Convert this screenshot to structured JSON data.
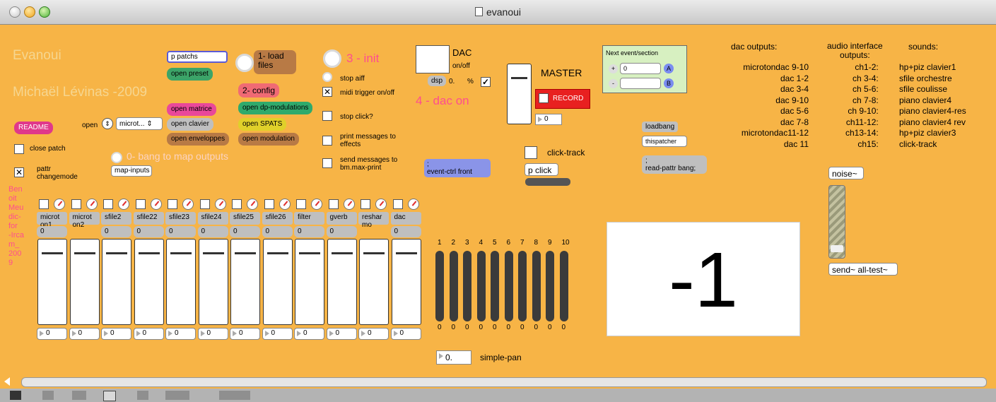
{
  "window": {
    "title": "evanoui"
  },
  "header": {
    "app_name": "Evanoui",
    "author": "Michaël Lévinas -2009"
  },
  "left": {
    "readme": "README",
    "open_label": "open",
    "open_select": "microt...",
    "close_patch": "close patch",
    "pattr_label": "pattr\nchangemode",
    "credit": "Ben\noit\nMeu\ndic-\nfor\n-Irca\nm_\n200\n9"
  },
  "buttons": {
    "p_patchs": "p patchs",
    "open_preset": "open preset",
    "load_files": "1- load\nfiles",
    "config": "2- config",
    "init": "3 - init",
    "open_matrice": "open matrice",
    "open_dp_modulations": "open dp-modulations",
    "open_clavier": "open clavier",
    "open_spats": "open SPATS",
    "open_enveloppes": "open enveloppes",
    "open_modulation": "open modulation",
    "bang_map": "0- bang to map outputs",
    "map_inputs": "map-inputs"
  },
  "init_panel": {
    "stop_aiff": "stop aiff",
    "midi_trigger": "midi trigger on/off",
    "stop_click": "stop click?",
    "print_messages": "print messages to\neffects",
    "send_messages": "send messages to\nbm.max-print"
  },
  "dac": {
    "title": "DAC",
    "onoff": "on/off",
    "dsp": "dsp",
    "cpu": "0.",
    "pct": "%",
    "dac_on": "4 - dac on",
    "event_ctrl": ";\nevent-ctrl front"
  },
  "master": {
    "label": "MASTER",
    "record": "RECORD",
    "value": "0"
  },
  "click": {
    "label": "click-track",
    "p_click": "p click"
  },
  "next_event": {
    "title": "Next event/section",
    "plus": "+",
    "minus": "-",
    "value": "0",
    "a": "A",
    "b": "B"
  },
  "misc": {
    "loadbang": "loadbang",
    "thispatcher": "thispatcher",
    "read_pattr": ";\nread-pattr bang;"
  },
  "dac_outputs": {
    "title": "dac outputs:",
    "lines": [
      "microtondac 9-10",
      "dac 1-2",
      "dac 3-4",
      "dac 9-10",
      "dac 5-6",
      "dac 7-8",
      "microtondac11-12",
      "dac 11"
    ]
  },
  "audio_interface": {
    "title": "audio interface\noutputs:",
    "lines": [
      "ch1-2:",
      "ch 3-4:",
      "ch 5-6:",
      "ch 7-8:",
      "ch 9-10:",
      "ch11-12:",
      "ch13-14:",
      "ch15:"
    ]
  },
  "sounds": {
    "title": "sounds:",
    "lines": [
      "hp+piz clavier1",
      "sfile orchestre",
      "sfile coulisse",
      "piano clavier4",
      "piano clavier4-res",
      "piano clavier4 rev",
      "hp+piz clavier3",
      "click-track"
    ]
  },
  "channels": [
    {
      "name": "microt\non1",
      "value": "0",
      "fader": "0"
    },
    {
      "name": "microt\non2",
      "value": "",
      "fader": "0"
    },
    {
      "name": "sfile2",
      "value": "0",
      "fader": "0"
    },
    {
      "name": "sfile22",
      "value": "0",
      "fader": "0"
    },
    {
      "name": "sfile23",
      "value": "0",
      "fader": "0"
    },
    {
      "name": "sfile24",
      "value": "0",
      "fader": "0"
    },
    {
      "name": "sfile25",
      "value": "0",
      "fader": "0"
    },
    {
      "name": "sfile26",
      "value": "0",
      "fader": "0"
    },
    {
      "name": "filter",
      "value": "0",
      "fader": "0"
    },
    {
      "name": "gverb",
      "value": "0",
      "fader": "0"
    },
    {
      "name": "reshar\nmo",
      "value": "",
      "fader": "0"
    },
    {
      "name": "dac",
      "value": "0",
      "fader": "0"
    }
  ],
  "meters": {
    "labels": [
      "1",
      "2",
      "3",
      "4",
      "5",
      "6",
      "7",
      "8",
      "9",
      "10"
    ],
    "values": [
      "0",
      "0",
      "0",
      "0",
      "0",
      "0",
      "0",
      "0",
      "0",
      "0"
    ]
  },
  "pan": {
    "value": "0.",
    "label": "simple-pan"
  },
  "big_number": "-1",
  "noise": {
    "noise": "noise~",
    "send": "send~ all-test~"
  }
}
